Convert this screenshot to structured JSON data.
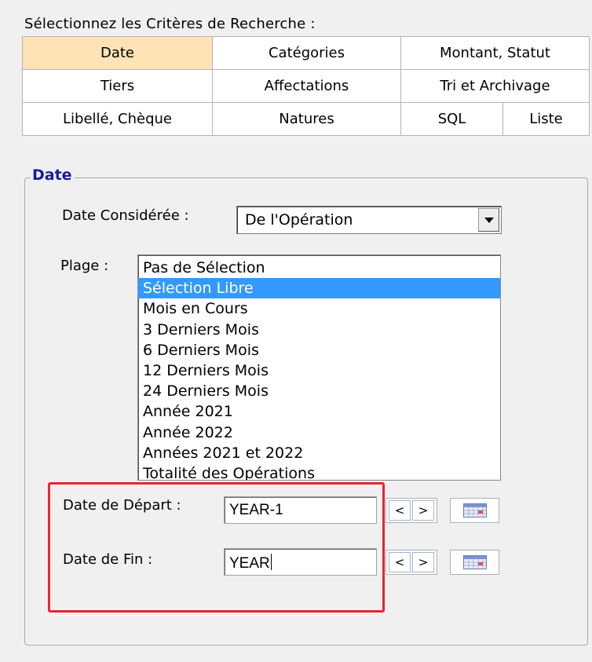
{
  "header": {
    "text": "Sélectionnez les Critères de Recherche :"
  },
  "tabs": [
    {
      "label": "Date",
      "active": true
    },
    {
      "label": "Catégories"
    },
    {
      "label": "Montant, Statut"
    },
    {
      "label": "Tiers"
    },
    {
      "label": "Affectations"
    },
    {
      "label": "Tri et Archivage"
    },
    {
      "label": "Libellé, Chèque"
    },
    {
      "label": "Natures"
    },
    {
      "label": "SQL"
    },
    {
      "label": "Liste"
    }
  ],
  "colors": {
    "active_tab": "#ffe3b6",
    "legend": "#1a1aa0",
    "selection": "#3399ff",
    "highlight_box": "#e8262d"
  },
  "date_section": {
    "legend": "Date",
    "date_consideree_label": "Date Considérée :",
    "date_consideree_value": "De l'Opération",
    "plage_label": "Plage :",
    "plage_options": [
      "Pas de Sélection",
      "Sélection Libre",
      "Mois en Cours",
      "3 Derniers Mois",
      "6 Derniers Mois",
      "12 Derniers Mois",
      "24 Derniers Mois",
      "Année 2021",
      "Année 2022",
      "Années 2021 et 2022",
      "Totalité des Opérations"
    ],
    "plage_selected": "Sélection Libre",
    "date_depart_label": "Date de Départ :",
    "date_depart_value": "YEAR-1",
    "date_fin_label": "Date de Fin :",
    "date_fin_value": "YEAR",
    "prev_label": "<",
    "next_label": ">",
    "calendar_icon": "calendar-icon"
  }
}
